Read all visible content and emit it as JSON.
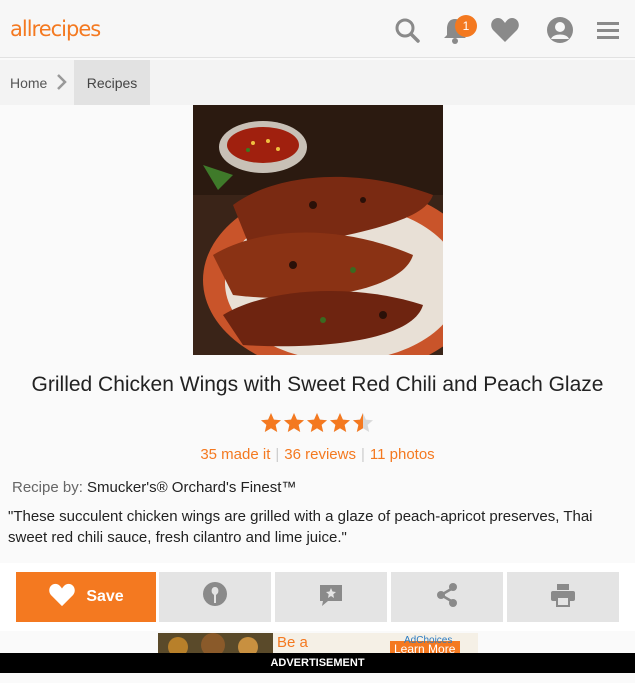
{
  "header": {
    "logo": "allrecipes",
    "notification_count": "1",
    "icons": [
      "search-icon",
      "bell-icon",
      "heart-icon",
      "user-icon",
      "menu-icon"
    ]
  },
  "breadcrumb": {
    "home": "Home",
    "current": "Recipes"
  },
  "recipe": {
    "title": "Grilled Chicken Wings with Sweet Red Chili and Peach Glaze",
    "rating": 4.5,
    "rating_max": 5,
    "made_it": "35 made it",
    "reviews": "36 reviews",
    "photos": "11 photos",
    "by_label": "Recipe by:",
    "author": "Smucker's® Orchard's Finest™",
    "description": "\"These succulent chicken wings are grilled with a glaze of peach-apricot preserves, Thai sweet red chili sauce, fresh cilantro and lime juice.\""
  },
  "actions": {
    "save_label": "Save",
    "icons": [
      "heart-icon",
      "made-it-icon",
      "review-icon",
      "share-icon",
      "print-icon"
    ]
  },
  "ad": {
    "text": "Be a",
    "choices": "AdChoices",
    "cta": "Learn More",
    "label": "ADVERTISEMENT"
  },
  "colors": {
    "brand": "#f47920",
    "button_bg": "#e4e4e4",
    "icon_gray": "#8a8a8a"
  }
}
